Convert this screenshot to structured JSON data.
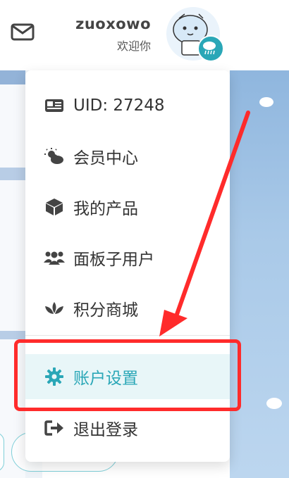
{
  "header": {
    "username": "zuoxowo",
    "greeting": "欢迎你",
    "mail_icon": "mail-icon",
    "avatar_icon": "seal-avatar",
    "badge_icon": "rain-cloud-icon"
  },
  "menu": {
    "items": [
      {
        "icon": "id-card-icon",
        "label": "UID: 27248"
      },
      {
        "icon": "weather-icon",
        "label": "会员中心"
      },
      {
        "icon": "box-icon",
        "label": "我的产品"
      },
      {
        "icon": "users-icon",
        "label": "面板子用户"
      },
      {
        "icon": "lotus-icon",
        "label": "积分商城"
      },
      {
        "icon": "gear-icon",
        "label": "账户设置"
      },
      {
        "icon": "sign-out-icon",
        "label": "退出登录"
      }
    ],
    "active_index": 5
  },
  "colors": {
    "accent": "#2aa7b7",
    "highlight_bg": "#e8f6f8",
    "annotation": "#ff2b2b",
    "text": "#333333"
  }
}
